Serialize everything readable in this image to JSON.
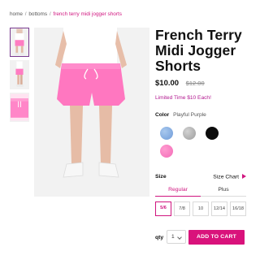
{
  "breadcrumb": {
    "home": "home",
    "separator": "/",
    "category": "bottoms",
    "current": "french terry midi jogger shorts"
  },
  "product": {
    "title_line1": "French Terry",
    "title_line2": "Midi Jogger",
    "title_line3": "Shorts",
    "price_now": "$10.00",
    "price_was": "$12.00",
    "promo": "Limited Time $10 Each!"
  },
  "color": {
    "label": "Color",
    "selected": "Playful Purple",
    "swatches": [
      {
        "name": "blue",
        "hex": "#8fb4e6"
      },
      {
        "name": "grey",
        "hex": "#b9b9b9"
      },
      {
        "name": "black",
        "hex": "#0c0c0c"
      },
      {
        "name": "pink",
        "hex": "#f77fc0"
      }
    ]
  },
  "size": {
    "label": "Size",
    "chart_link": "Size Chart",
    "fit_tabs": [
      "Regular",
      "Plus"
    ],
    "options": [
      "5/6",
      "7/8",
      "10",
      "12/14",
      "16/18"
    ],
    "selected": "5/6"
  },
  "purchase": {
    "qty_label": "qty",
    "qty_value": "1",
    "add_button": "ADD TO CART"
  },
  "colors": {
    "accent": "#d9127b",
    "promo_text": "#b2178f",
    "thumb_border": "#7a3b8f"
  }
}
